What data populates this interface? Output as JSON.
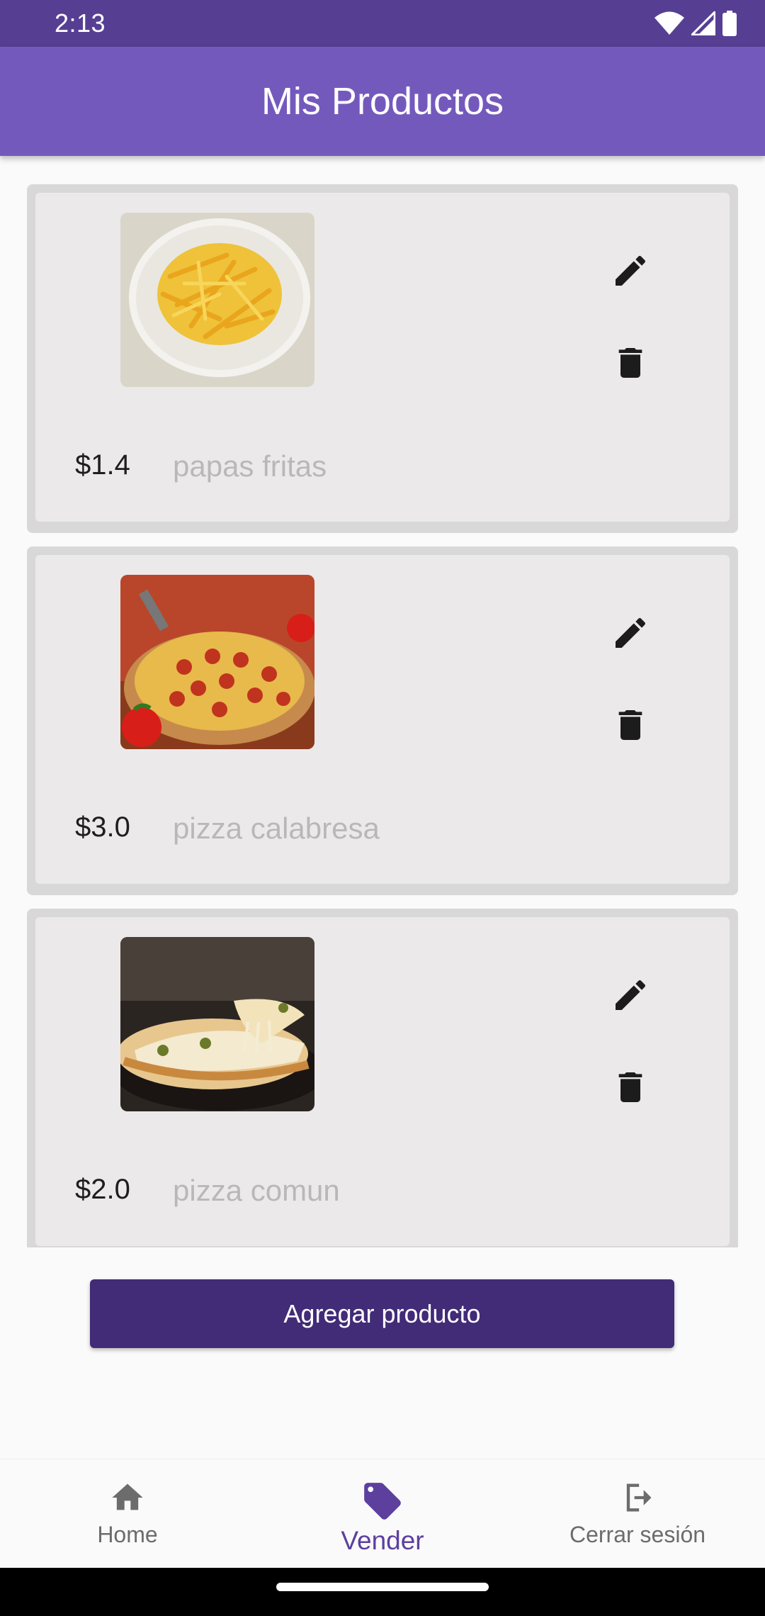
{
  "status_bar": {
    "time": "2:13"
  },
  "app_bar": {
    "title": "Mis Productos"
  },
  "products": [
    {
      "price": "$1.4",
      "name": "papas fritas",
      "image_icon": "fries-photo"
    },
    {
      "price": "$3.0",
      "name": "pizza calabresa",
      "image_icon": "pepperoni-pizza-photo"
    },
    {
      "price": "$2.0",
      "name": "pizza comun",
      "image_icon": "cheese-pizza-photo"
    }
  ],
  "add_button_label": "Agregar producto",
  "bottom_nav": [
    {
      "label": "Home",
      "icon": "home-icon",
      "active": false
    },
    {
      "label": "Vender",
      "icon": "tag-icon",
      "active": true
    },
    {
      "label": "Cerrar sesión",
      "icon": "logout-icon",
      "active": false
    }
  ],
  "colors": {
    "status_bar": "#563f93",
    "app_bar": "#7459bd",
    "primary_button": "#422b77",
    "active_nav": "#5d3f9e"
  }
}
